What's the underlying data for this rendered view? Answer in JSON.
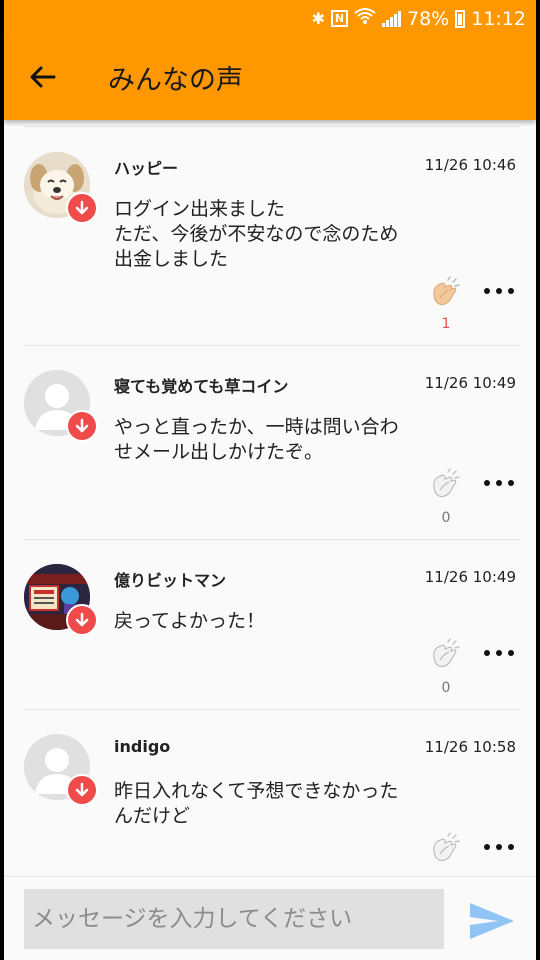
{
  "status_bar": {
    "battery": "78%",
    "time": "11:12",
    "nfc_letter": "N"
  },
  "header": {
    "title": "みんなの声"
  },
  "posts": [
    {
      "name": "ハッピー",
      "time": "11/26 10:46",
      "message": "ログイン出来ました\nただ、今後が不安なので念のため\n出金しました",
      "claps": "1",
      "avatar": "dog-photo",
      "clapped": true
    },
    {
      "name": "寝ても覚めても草コイン",
      "time": "11/26 10:49",
      "message": "やっと直ったか、一時は問い合わ\nせメール出しかけたぞ。",
      "claps": "0",
      "avatar": "default-person",
      "clapped": false
    },
    {
      "name": "億りビットマン",
      "time": "11/26 10:49",
      "message": "戻ってよかった！",
      "claps": "0",
      "avatar": "illustration",
      "clapped": false
    },
    {
      "name": "indigo",
      "time": "11/26 10:58",
      "message": "昨日入れなくて予想できなかった\nんだけど",
      "claps": "",
      "avatar": "default-person",
      "clapped": false
    }
  ],
  "composer": {
    "placeholder": "メッセージを入力してください"
  },
  "colors": {
    "accent": "#ff9800",
    "badge": "#ef4b4b",
    "clap_active": "#f3c89a",
    "count_red": "#d9534f",
    "send": "#90c4f5"
  }
}
